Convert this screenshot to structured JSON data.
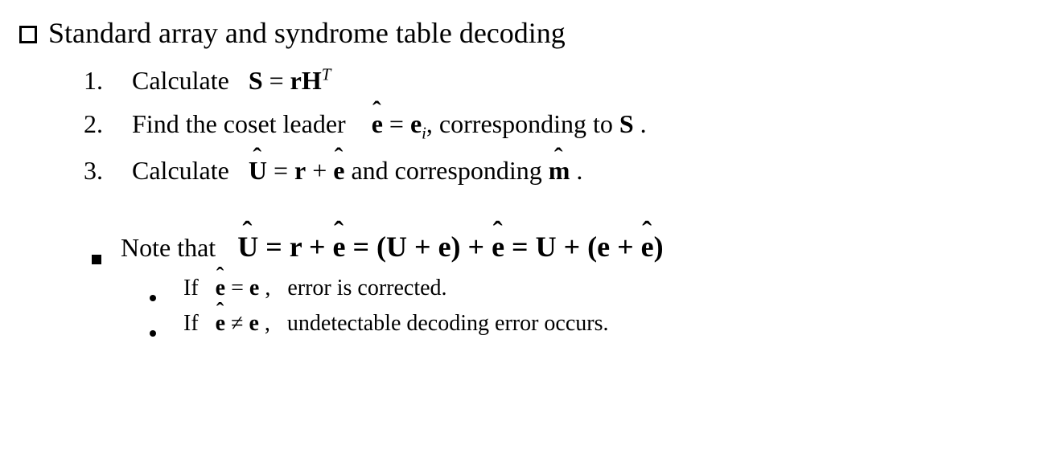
{
  "header": {
    "title": "Standard array and syndrome table decoding"
  },
  "steps": {
    "n1": "1.",
    "n2": "2.",
    "n3": "3.",
    "calc": "Calculate",
    "s1_S": "S",
    "eq": " = ",
    "s1_r": "r",
    "s1_H": "H",
    "s1_T": "T",
    "s2_pre": "Find the coset leader",
    "ehat": "ê",
    "s2_ei": "e",
    "sub_i": "i",
    "s2_mid": ",  corresponding to ",
    "s2_S": "S",
    "period": " .",
    "s3_U": "U",
    "s3_r": "r",
    "plus": " + ",
    "s3_mid": "  and corresponding  ",
    "s3_m": "m"
  },
  "note": {
    "pre": "Note that",
    "Uhat": "U",
    "eq": " = ",
    "r": "r",
    "plus": " + ",
    "ehat": "e",
    "lp": "(",
    "U": "U",
    "e": "e",
    "rp": ")"
  },
  "cases": {
    "if": "If",
    "eq": " = ",
    "neq": " ≠ ",
    "e": "e",
    "comma": " ,",
    "c1_text": "  error is corrected.",
    "c2_text": "  undetectable decoding error occurs."
  }
}
